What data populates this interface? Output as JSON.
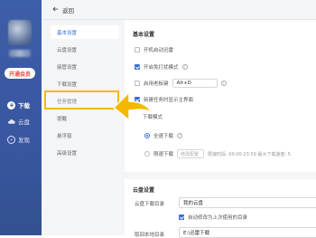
{
  "sidebar": {
    "vip_label": "开通会员",
    "items": [
      {
        "label": "下载",
        "icon": "download-icon",
        "active": true
      },
      {
        "label": "云盘",
        "icon": "cloud-icon",
        "active": false
      },
      {
        "label": "发现",
        "icon": "discover-icon",
        "active": false
      }
    ]
  },
  "topbar": {
    "back_label": "返回",
    "back_icon": "back-arrow-icon"
  },
  "menu": {
    "items": [
      {
        "label": "基本设置",
        "active": true
      },
      {
        "label": "云盘设置",
        "active": false
      },
      {
        "label": "接管设置",
        "active": false
      },
      {
        "label": "下载设置",
        "active": false
      },
      {
        "label": "任务管理",
        "active": false
      },
      {
        "label": "提醒",
        "active": false
      },
      {
        "label": "悬浮窗",
        "active": false
      },
      {
        "label": "高级设置",
        "active": false
      }
    ]
  },
  "basic": {
    "title": "基本设置",
    "autostart": {
      "label": "开机启动迅雷",
      "checked": false
    },
    "freedownload": {
      "label": "开启免打扰模式",
      "checked": true
    },
    "bosskey": {
      "label": "启用老板键",
      "value": "Alt+D",
      "checked": false
    },
    "newtask": {
      "label": "新建任务时显示主界面",
      "checked": true
    },
    "download_mode": {
      "title": "下载模式",
      "options": [
        {
          "label": "全速下载",
          "selected": true
        },
        {
          "label": "限速下载",
          "selected": false
        }
      ],
      "speed_placeholder": "修改配置",
      "speed_hint": "限速时段: 00:00-23:59 最大下载速度: 5"
    }
  },
  "cloud": {
    "title": "云盘设置",
    "dir_label": "云盘下载目录",
    "dir_value": "我的云盘",
    "auto_change": {
      "label": "自动修改为上次使用的目录",
      "checked": true
    },
    "local_label": "取回本地目录",
    "local_value": "E:\\迅雷下载"
  },
  "colors": {
    "accent": "#3b6fd8",
    "highlight": "#f5b800",
    "sidebar": "#3d5ea8"
  }
}
